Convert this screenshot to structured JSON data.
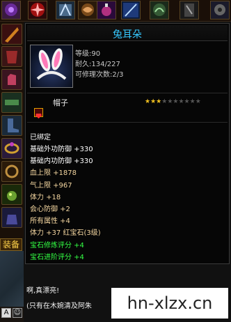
{
  "item": {
    "name": "兔耳朵",
    "level": "等级:90",
    "durability": "耐久:134/227",
    "repairs": "可修理次数:2/3",
    "type": "帽子",
    "stars_filled": 3,
    "stars_total": 10,
    "bound": "已绑定",
    "props": [
      {
        "text": "基础外功防御 +330",
        "color": "#ffffff"
      },
      {
        "text": "基础内功防御 +330",
        "color": "#ffffff"
      },
      {
        "text": "血上限 +1878",
        "color": "#f4d6a0"
      },
      {
        "text": "气上限 +967",
        "color": "#f4d6a0"
      },
      {
        "text": "体力 +18",
        "color": "#f4d6a0"
      },
      {
        "text": "会心防御 +2",
        "color": "#f4d6a0"
      },
      {
        "text": "所有属性 +4",
        "color": "#f4d6a0"
      },
      {
        "text": "体力 +37 红宝石(3级)",
        "color": "#f4d6a0"
      },
      {
        "text": "宝石修炼评分 +4",
        "color": "#33ff44"
      },
      {
        "text": "宝石进阶评分 +4",
        "color": "#33ff44"
      }
    ]
  },
  "left_panel": {
    "equip_tab": "装备",
    "bottom_icons": [
      "A",
      "☺"
    ]
  },
  "chat": {
    "line1": "啊,真漂亮!",
    "line2": "(只有在木婉清及阿朱"
  },
  "watermark": "hn-xlzx.cn"
}
